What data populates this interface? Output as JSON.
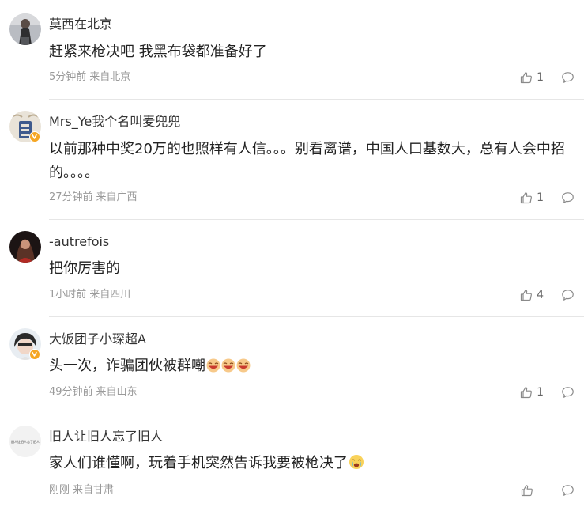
{
  "comments": [
    {
      "username": "莫西在北京",
      "content": "赶紧来枪决吧 我黑布袋都准备好了",
      "time": "5分钟前",
      "location": "来自北京",
      "likes": "1",
      "verified": false
    },
    {
      "username": "Mrs_Ye我个名叫麦兜兜",
      "content": "以前那种中奖20万的也照样有人信。。。别看离谱，中国人口基数大，总有人会中招的。。。。",
      "time": "27分钟前",
      "location": "来自广西",
      "likes": "1",
      "verified": true
    },
    {
      "username": "-autrefois",
      "content": "把你厉害的",
      "time": "1小时前",
      "location": "来自四川",
      "likes": "4",
      "verified": false
    },
    {
      "username": "大饭团子小琛超A",
      "content": "头一次，诈骗团伙被群嘲",
      "emoji": "laughing-emoji",
      "time": "49分钟前",
      "location": "来自山东",
      "likes": "1",
      "verified": true
    },
    {
      "username": "旧人让旧人忘了旧人",
      "content": "家人们谁懂啊，玩着手机突然告诉我要被枪决了",
      "emoji": "crying-emoji",
      "time": "刚刚",
      "location": "来自甘肃",
      "likes": "",
      "verified": false,
      "avatar_text": "旧人让旧人忘了旧人"
    }
  ],
  "colors": {
    "text": "#222222",
    "meta": "#9a9a9a",
    "divider": "#e6e6e6",
    "badge": "#f5a623"
  }
}
